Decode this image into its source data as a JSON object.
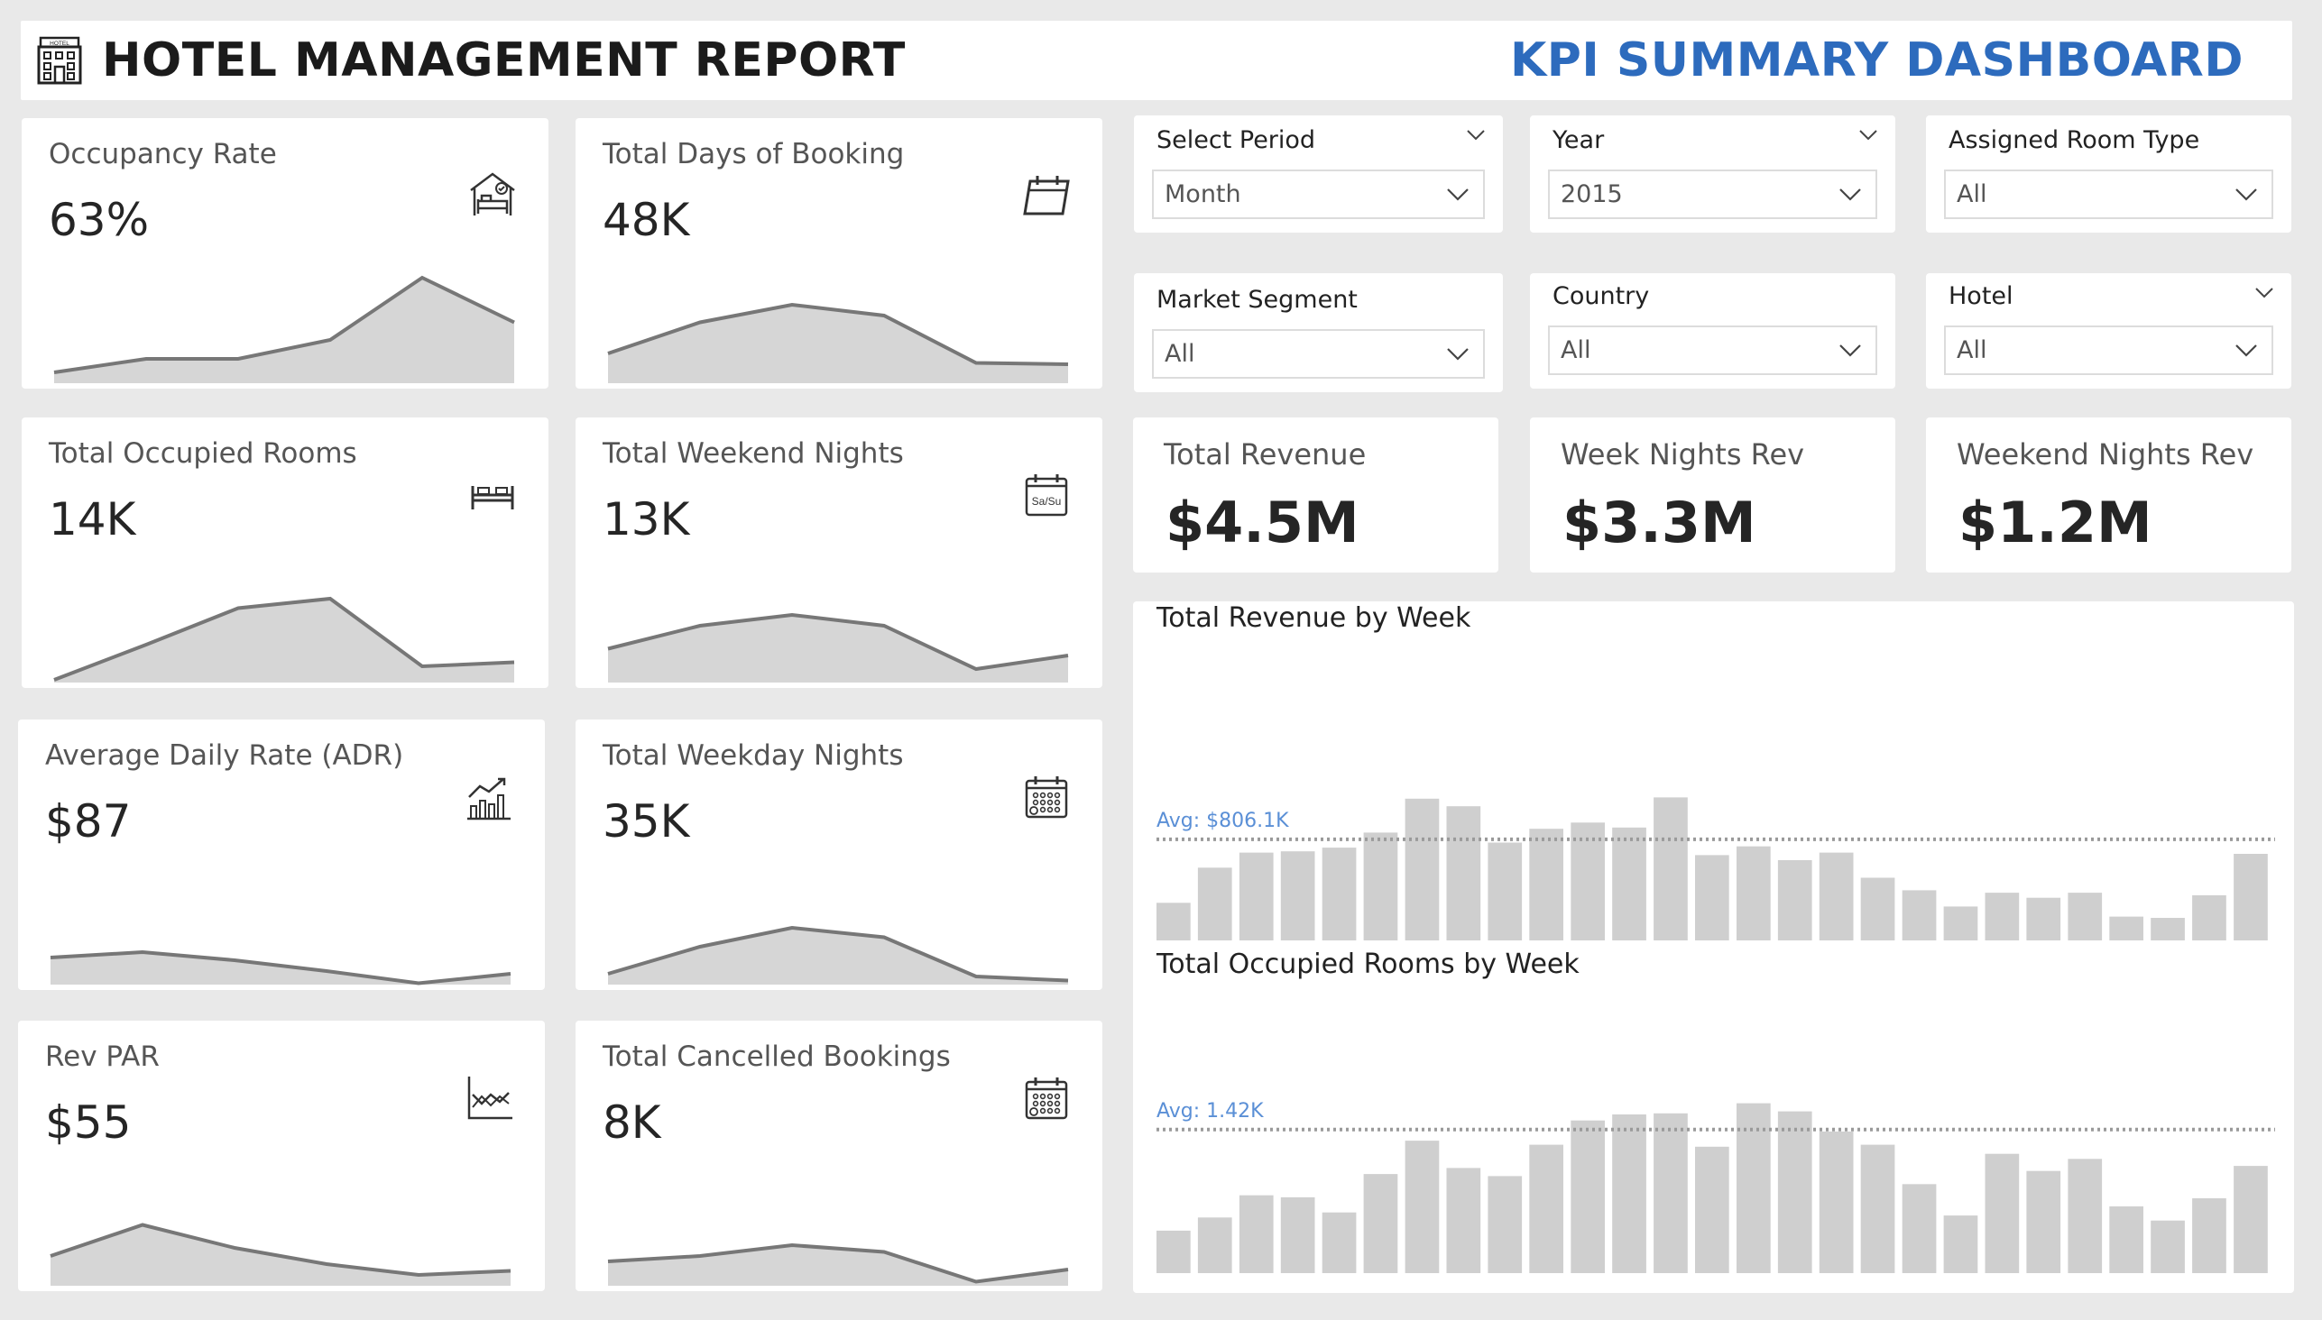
{
  "header": {
    "report_title": "HOTEL MANAGEMENT REPORT",
    "dashboard_title": "KPI SUMMARY DASHBOARD",
    "accent_color": "#2d6bbd",
    "icon": "hotel-building-icon"
  },
  "kpis": [
    {
      "id": "occupancy-rate",
      "label": "Occupancy Rate",
      "value": "63%",
      "icon": "bed-house-icon",
      "trend": [
        0.08,
        0.18,
        0.18,
        0.32,
        0.78,
        0.45
      ]
    },
    {
      "id": "total-days-of-booking",
      "label": "Total Days of Booking",
      "value": "48K",
      "icon": "calendar-icon",
      "trend": [
        0.22,
        0.45,
        0.58,
        0.5,
        0.15,
        0.14
      ]
    },
    {
      "id": "total-occupied-rooms",
      "label": "Total Occupied Rooms",
      "value": "14K",
      "icon": "bed-icon",
      "trend": [
        0.02,
        0.28,
        0.55,
        0.62,
        0.12,
        0.15
      ]
    },
    {
      "id": "total-weekend-nights",
      "label": "Total Weekend Nights",
      "value": "13K",
      "icon": "weekend-calendar-icon",
      "trend": [
        0.25,
        0.42,
        0.5,
        0.42,
        0.1,
        0.2
      ]
    },
    {
      "id": "average-daily-rate",
      "label": "Average Daily Rate (ADR)",
      "value": "$87",
      "icon": "growth-chart-icon",
      "trend": [
        0.2,
        0.24,
        0.18,
        0.1,
        0.01,
        0.08
      ]
    },
    {
      "id": "total-weekday-nights",
      "label": "Total Weekday Nights",
      "value": "35K",
      "icon": "calendar-grid-icon",
      "trend": [
        0.08,
        0.28,
        0.42,
        0.35,
        0.06,
        0.03
      ]
    },
    {
      "id": "rev-par",
      "label": "Rev PAR",
      "value": "$55",
      "icon": "line-chart-icon",
      "trend": [
        0.22,
        0.45,
        0.28,
        0.16,
        0.08,
        0.11
      ]
    },
    {
      "id": "total-cancelled-bookings",
      "label": "Total Cancelled Bookings",
      "value": "8K",
      "icon": "calendar-grid-icon",
      "trend": [
        0.18,
        0.22,
        0.3,
        0.25,
        0.03,
        0.12
      ]
    }
  ],
  "slicers": [
    {
      "id": "select-period",
      "label": "Select Period",
      "value": "Month",
      "header_caret": true
    },
    {
      "id": "year",
      "label": "Year",
      "value": "2015",
      "header_caret": true
    },
    {
      "id": "assigned-room-type",
      "label": "Assigned Room Type",
      "value": "All",
      "header_caret": false
    },
    {
      "id": "market-segment",
      "label": "Market Segment",
      "value": "All",
      "header_caret": false
    },
    {
      "id": "country",
      "label": "Country",
      "value": "All",
      "header_caret": false
    },
    {
      "id": "hotel",
      "label": "Hotel",
      "value": "All",
      "header_caret": true
    }
  ],
  "revenue_cards": [
    {
      "id": "total-revenue",
      "label": "Total Revenue",
      "value": "$4.5M"
    },
    {
      "id": "week-nights-rev",
      "label": "Week Nights Rev",
      "value": "$3.3M"
    },
    {
      "id": "weekend-nights-rev",
      "label": "Weekend Nights Rev",
      "value": "$1.2M"
    }
  ],
  "chart_data": [
    {
      "type": "bar",
      "title": "Total Revenue by Week",
      "avg_label": "Avg: $806.1K",
      "avg_value": 806.1,
      "ylim": [
        0,
        2200
      ],
      "grid": false,
      "values": [
        300,
        580,
        700,
        710,
        740,
        860,
        1130,
        1070,
        780,
        890,
        940,
        900,
        1140,
        680,
        750,
        640,
        700,
        500,
        400,
        270,
        380,
        340,
        380,
        190,
        180,
        360,
        690
      ]
    },
    {
      "type": "bar",
      "title": "Total Occupied Rooms by Week",
      "avg_label": "Avg: 1.42K",
      "avg_value": 1.42,
      "ylim": [
        0,
        2.72
      ],
      "grid": false,
      "values": [
        0.42,
        0.55,
        0.77,
        0.75,
        0.6,
        0.98,
        1.31,
        1.04,
        0.96,
        1.27,
        1.51,
        1.57,
        1.58,
        1.25,
        1.68,
        1.6,
        1.4,
        1.27,
        0.88,
        0.57,
        1.18,
        1.01,
        1.13,
        0.66,
        0.52,
        0.74,
        1.06
      ]
    }
  ]
}
